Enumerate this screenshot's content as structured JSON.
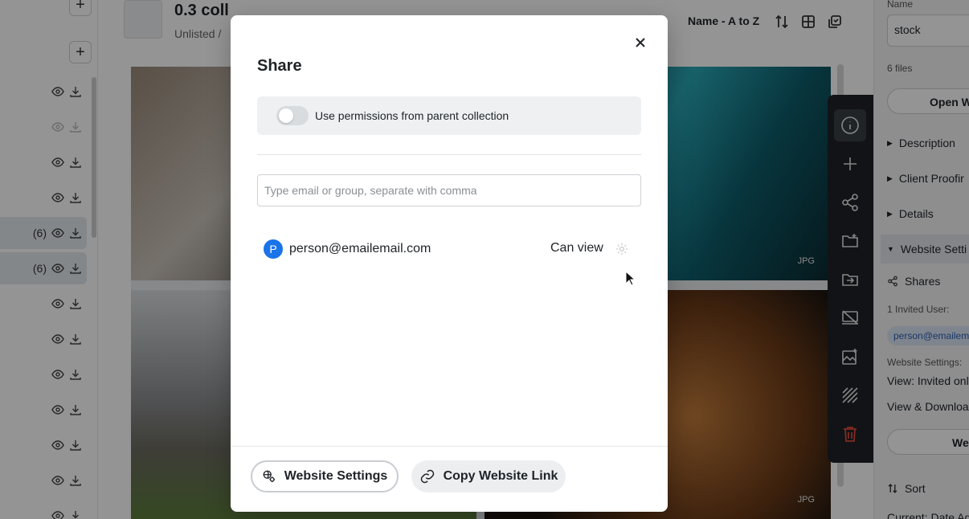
{
  "collection": {
    "title": "0.3 coll",
    "subtitle": "Unlisted /"
  },
  "toolbar": {
    "sort_label": "Name - A to Z"
  },
  "sidebar": {
    "rows": [
      {
        "count": ""
      },
      {
        "count": ""
      },
      {
        "count": ""
      },
      {
        "count": ""
      },
      {
        "count": "(6)"
      },
      {
        "count": "(6)"
      },
      {
        "count": ""
      },
      {
        "count": ""
      },
      {
        "count": ""
      },
      {
        "count": ""
      },
      {
        "count": ""
      },
      {
        "count": ""
      },
      {
        "count": ""
      }
    ]
  },
  "photos": [
    {
      "badge": ""
    },
    {
      "badge": "JPG"
    },
    {
      "badge": ""
    },
    {
      "badge": "JPG"
    }
  ],
  "right_panel": {
    "name_label": "Name",
    "name_value": "stock",
    "files": "6 files",
    "open_button": "Open W",
    "sections": [
      "Description",
      "Client Proofir",
      "Details",
      "Website Setti"
    ],
    "shares": "Shares",
    "invited": "1 Invited User:",
    "invited_chip": "person@emailem",
    "website_settings_label": "Website Settings:",
    "view_line": "View: Invited only",
    "view_download_line": "View & Downloac",
    "web_button": "Wel",
    "sort": "Sort",
    "current": "Current: Date Ad"
  },
  "modal": {
    "title": "Share",
    "permission_label": "Use permissions from parent collection",
    "permission_enabled": false,
    "email_placeholder": "Type email or group, separate with comma",
    "email_value": "",
    "person": {
      "initial": "P",
      "email": "person@emailemail.com",
      "role": "Can view"
    },
    "website_settings_button": "Website Settings",
    "copy_link_button": "Copy Website Link"
  },
  "colors": {
    "accent": "#1a73e8",
    "danger": "#e04a3a",
    "rail": "#1f2226"
  }
}
